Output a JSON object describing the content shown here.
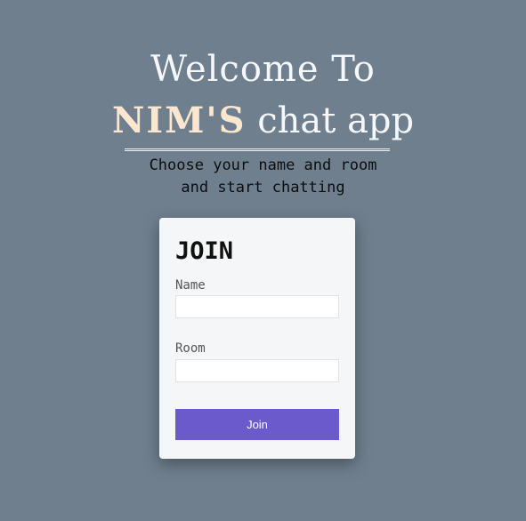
{
  "hero": {
    "welcome": "Welcome To",
    "brand": "NIM'S",
    "title_rest": "chat app",
    "subtitle_line1": "Choose your name and room",
    "subtitle_line2": "and start chatting"
  },
  "form": {
    "title": "JOIN",
    "name_label": "Name",
    "name_value": "",
    "room_label": "Room",
    "room_value": "",
    "submit_label": "Join"
  },
  "colors": {
    "background": "#6f7f8e",
    "brand": "#fbe7cf",
    "card": "#f5f6f8",
    "button": "#6b5acb"
  }
}
